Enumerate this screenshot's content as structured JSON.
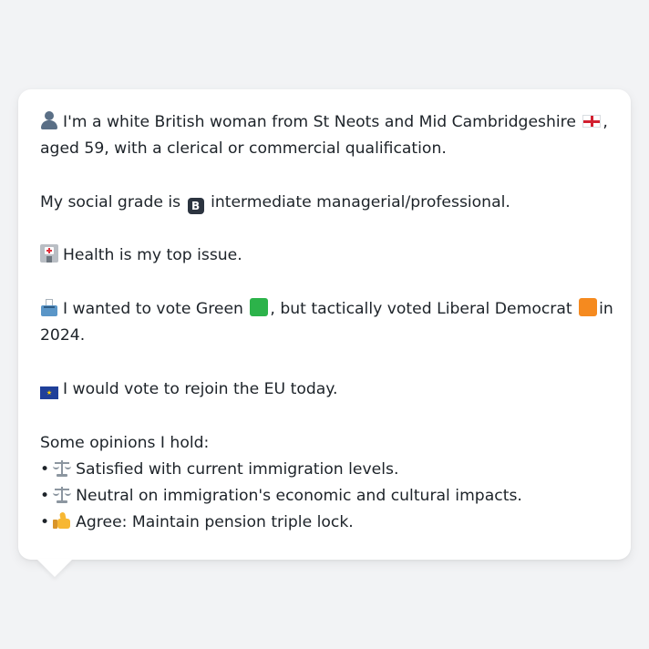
{
  "message": {
    "intro_line1": "I'm a white British woman from St Neots and Mid Cambridgeshire",
    "intro_line1_end": ",",
    "intro_line2": "aged 59, with a clerical or commercial qualification.",
    "social_grade_prefix": "My social grade is",
    "social_grade_suffix": "intermediate managerial/professional.",
    "health_text": "Health is my top issue.",
    "vote_part1": "I wanted to vote Green",
    "vote_part2": ", but tactically voted Liberal Democrat",
    "vote_part3": "in",
    "vote_line2": "2024.",
    "eu_text": "I would vote to rejoin the EU today.",
    "opinions_heading": "Some opinions I hold:",
    "bullet_char": "•",
    "opinions": [
      {
        "icon": "scales-icon",
        "text": "Satisfied with current immigration levels."
      },
      {
        "icon": "scales-icon",
        "text": "Neutral on immigration's economic and cultural impacts."
      },
      {
        "icon": "thumbs-up-icon",
        "text": "Agree: Maintain pension triple lock."
      }
    ]
  },
  "colors": {
    "green_party": "#2cb34a",
    "lib_dem": "#f58a1f"
  },
  "icons": {
    "person": "person-silhouette-icon",
    "flag_england": "england-flag-icon",
    "social_grade_badge": "B",
    "health": "hospital-icon",
    "vote": "ballot-box-icon",
    "eu_flag": "eu-flag-icon"
  }
}
